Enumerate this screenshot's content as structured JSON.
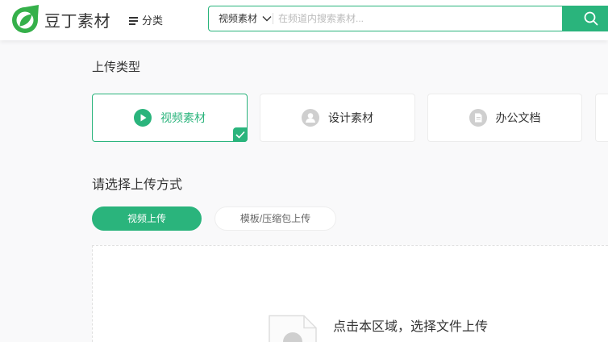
{
  "header": {
    "logo_text": "豆丁素材",
    "logo_icon": "leaf-logo-icon",
    "category_label": "分类",
    "category_icon": "menu-icon",
    "search": {
      "scope": "视频素材",
      "scope_icon": "chevron-down-icon",
      "placeholder": "在频道内搜索素材...",
      "value": "",
      "button_icon": "search-icon"
    }
  },
  "upload_type": {
    "title": "上传类型",
    "cards": [
      {
        "label": "视频素材",
        "icon": "play-circle-icon",
        "selected": true
      },
      {
        "label": "设计素材",
        "icon": "user-circle-icon",
        "selected": false
      },
      {
        "label": "办公文档",
        "icon": "document-circle-icon",
        "selected": false
      }
    ]
  },
  "upload_method": {
    "title": "请选择上传方式",
    "tabs": [
      {
        "label": "视频上传",
        "active": true
      },
      {
        "label": "模板/压缩包上传",
        "active": false
      }
    ]
  },
  "dropzone": {
    "prompt": "点击本区域，选择文件上传",
    "icon": "file-icon"
  },
  "colors": {
    "accent": "#2ab47c",
    "logo_green": "#35b04a",
    "icon_gray": "#cfcfcf",
    "placeholder": "#bbbbbb"
  }
}
